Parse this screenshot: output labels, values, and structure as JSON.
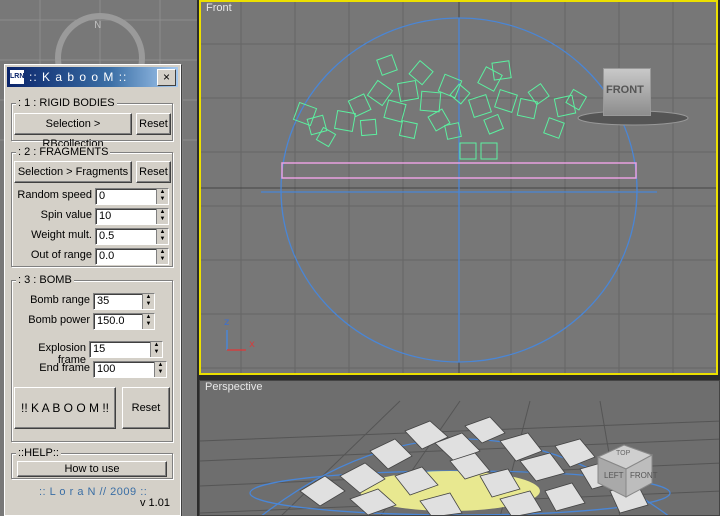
{
  "viewports": {
    "front": {
      "label": "Front",
      "navcube": "FRONT"
    },
    "perspective": {
      "label": "Perspective",
      "navcube_top": "TOP",
      "navcube_left": "LEFT",
      "navcube_front": "FRONT"
    }
  },
  "dialog": {
    "icon": "LRN",
    "title": ":: K a b o o M ::",
    "close": "×",
    "groups": {
      "rigid": {
        "title": ": 1 : RIGID BODIES",
        "selection_btn": "Selection > RBcollection",
        "reset_btn": "Reset"
      },
      "fragments": {
        "title": ": 2 : FRAGMENTS",
        "selection_btn": "Selection > Fragments",
        "reset_btn": "Reset",
        "fields": [
          {
            "label": "Random speed",
            "value": "0"
          },
          {
            "label": "Spin value",
            "value": "10"
          },
          {
            "label": "Weight mult.",
            "value": "0.5"
          },
          {
            "label": "Out of range",
            "value": "0.0"
          }
        ]
      },
      "bomb": {
        "title": ": 3 : BOMB",
        "bomb_range_label": "Bomb range",
        "bomb_range": "35",
        "bomb_power_label": "Bomb power",
        "bomb_power": "150.0",
        "explosion_frame_label": "Explosion frame",
        "explosion_frame": "15",
        "end_frame_label": "End frame",
        "end_frame": "100",
        "kaboom_btn": "!! K A B O O M !!",
        "reset_btn": "Reset"
      },
      "help": {
        "title": "::HELP::",
        "how_btn": "How to use",
        "credit": ":: L o r a N // 2009 ::",
        "version": "v 1.01"
      }
    }
  },
  "colors": {
    "active_border": "#ece000",
    "gizmo": "#4a86d6",
    "cubes": "#5cf0a0"
  }
}
